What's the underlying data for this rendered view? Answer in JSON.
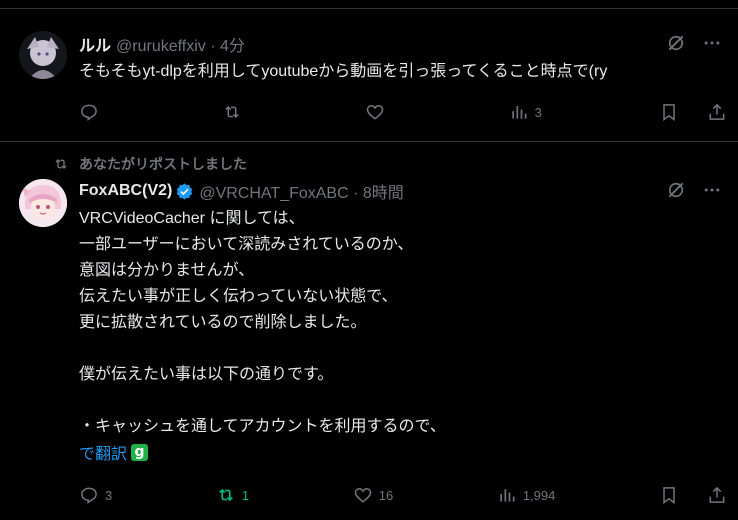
{
  "tweets": [
    {
      "name": "ルル",
      "handle": "@rurukeffxiv · 4分",
      "text": "そもそもyt-dlpを利用してyoutubeから動画を引っ張ってくること時点で(ry",
      "reply_count": "",
      "repost_count": "",
      "like_count": "",
      "view_count": "3"
    },
    {
      "repost_banner": "あなたがリポストしました",
      "name": "FoxABC(V2)",
      "handle": "@VRCHAT_FoxABC · 8時間",
      "text": "VRCVideoCacher に関しては、\n一部ユーザーにおいて深読みされているのか、\n意図は分かりませんが、\n伝えたい事が正しく伝わっていない状態で、\n更に拡散されているので削除しました。\n\n僕が伝えたい事は以下の通りです。\n\n・キャッシュを通してアカウントを利用するので、",
      "translate_label": "で翻訳",
      "translate_badge": "g",
      "reply_count": "3",
      "repost_count": "1",
      "like_count": "16",
      "view_count": "1,994"
    }
  ],
  "colors": {
    "accent": "#1d9bf0",
    "repost_active": "#00ba7c",
    "muted": "#71767b",
    "text": "#e7e9ea",
    "divider": "#2f3336"
  },
  "icons": [
    "reply-icon",
    "repost-icon",
    "like-icon",
    "views-icon",
    "bookmark-icon",
    "share-icon",
    "grok-icon",
    "more-icon",
    "verified-icon"
  ]
}
